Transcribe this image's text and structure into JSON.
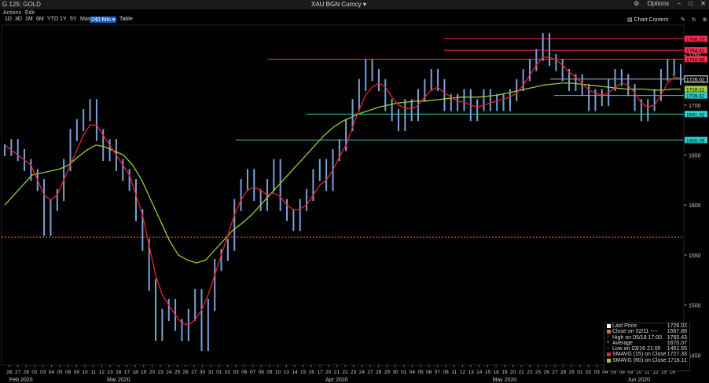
{
  "window": {
    "title_left": "G 125: GOLD",
    "security": "XAU BGN Curncy",
    "options_label": "Options"
  },
  "toolbar": {
    "actions_label": "Actions",
    "edit_label": "Edit",
    "ranges": [
      "1D",
      "3D",
      "1M",
      "6M",
      "YTD",
      "1Y",
      "5Y",
      "Max",
      "240 Min",
      "Table"
    ],
    "active_range": "240 Min",
    "chart_content_label": "Chart Content"
  },
  "colors": {
    "price_bars": "#7aa2d8",
    "sma15": "#e8232d",
    "sma60": "#9acd32",
    "resistance": "#ff2a4d",
    "support": "#2dd4d4",
    "close_marker": "#d87a1a",
    "last_price_label": "#ffffff"
  },
  "chart_data": {
    "type": "line",
    "title": "",
    "ylim": [
      1440,
      1780
    ],
    "y_ticks": [
      1450,
      1500,
      1550,
      1600,
      1650,
      1700,
      1750
    ],
    "x_ticks": [
      "26",
      "27",
      "28",
      "02",
      "03",
      "04",
      "05",
      "06",
      "09",
      "10",
      "11",
      "12",
      "13",
      "16",
      "17",
      "18",
      "19",
      "20",
      "23",
      "24",
      "25",
      "26",
      "27",
      "30",
      "31",
      "01",
      "02",
      "03",
      "06",
      "07",
      "08",
      "09",
      "10",
      "13",
      "14",
      "15",
      "16",
      "17",
      "20",
      "21",
      "22",
      "23",
      "24",
      "27",
      "28",
      "29",
      "30",
      "01",
      "04",
      "05",
      "06",
      "07",
      "08",
      "11",
      "12",
      "13",
      "14",
      "15",
      "18",
      "19",
      "20",
      "21",
      "22",
      "25",
      "26",
      "27",
      "28",
      "29",
      "01",
      "02",
      "03",
      "04",
      "05",
      "08",
      "09",
      "10",
      "11",
      "12",
      "15",
      "16"
    ],
    "months": [
      {
        "label": "Feb 2020",
        "tick": "26"
      },
      {
        "label": "Mar 2020",
        "tick": "13"
      },
      {
        "label": "Apr 2020",
        "tick": "16"
      },
      {
        "label": "May 2020",
        "tick": "13"
      },
      {
        "label": "Jun 2020",
        "tick": "08"
      }
    ],
    "horizontal_levels": [
      {
        "value": 1766.23,
        "label": "1766.23",
        "kind": "resistance"
      },
      {
        "value": 1754.81,
        "label": "1754.81",
        "kind": "resistance"
      },
      {
        "value": 1745.98,
        "label": "1745.98",
        "kind": "resistance"
      },
      {
        "value": 1726.02,
        "label": "1726.02",
        "kind": "last"
      },
      {
        "value": 1716.11,
        "label": "1716.11",
        "kind": "sma60"
      },
      {
        "value": 1709.62,
        "label": "1709.62",
        "kind": "support"
      },
      {
        "value": 1691.02,
        "label": "1691.02",
        "kind": "support"
      },
      {
        "value": 1665.05,
        "label": "1665.05",
        "kind": "support"
      }
    ],
    "close_reference": 1567.89,
    "price_points": [
      1655,
      1660,
      1650,
      1640,
      1630,
      1620,
      1575,
      1600,
      1610,
      1640,
      1670,
      1680,
      1690,
      1700,
      1670,
      1650,
      1660,
      1640,
      1630,
      1620,
      1590,
      1560,
      1520,
      1470,
      1490,
      1500,
      1480,
      1470,
      1490,
      1510,
      1460,
      1500,
      1540,
      1550,
      1560,
      1600,
      1620,
      1630,
      1610,
      1600,
      1620,
      1640,
      1600,
      1590,
      1580,
      1600,
      1610,
      1630,
      1640,
      1620,
      1650,
      1660,
      1680,
      1700,
      1720,
      1740,
      1730,
      1720,
      1700,
      1690,
      1680,
      1700,
      1690,
      1710,
      1720,
      1730,
      1720,
      1700,
      1705,
      1700,
      1710,
      1690,
      1700,
      1710,
      1700,
      1705,
      1700,
      1710,
      1720,
      1730,
      1740,
      1750,
      1766,
      1745,
      1740,
      1730,
      1720,
      1725,
      1715,
      1700,
      1710,
      1705,
      1720,
      1730,
      1725,
      1715,
      1700,
      1690,
      1700,
      1710,
      1730,
      1740,
      1735,
      1726
    ],
    "sma15_points": [
      1660,
      1655,
      1650,
      1645,
      1640,
      1625,
      1610,
      1605,
      1610,
      1625,
      1640,
      1655,
      1670,
      1680,
      1680,
      1670,
      1660,
      1650,
      1640,
      1630,
      1610,
      1590,
      1560,
      1530,
      1510,
      1500,
      1490,
      1482,
      1480,
      1485,
      1495,
      1510,
      1530,
      1550,
      1570,
      1590,
      1605,
      1615,
      1618,
      1615,
      1610,
      1612,
      1608,
      1600,
      1595,
      1596,
      1600,
      1610,
      1620,
      1625,
      1635,
      1648,
      1660,
      1678,
      1695,
      1710,
      1718,
      1722,
      1718,
      1708,
      1700,
      1697,
      1696,
      1700,
      1708,
      1715,
      1718,
      1712,
      1708,
      1704,
      1703,
      1700,
      1698,
      1700,
      1702,
      1704,
      1706,
      1708,
      1712,
      1720,
      1730,
      1740,
      1748,
      1748,
      1745,
      1740,
      1733,
      1728,
      1722,
      1715,
      1712,
      1710,
      1712,
      1718,
      1722,
      1720,
      1712,
      1702,
      1698,
      1700,
      1710,
      1722,
      1728,
      1727
    ],
    "sma60_points": [
      1600,
      1610,
      1620,
      1630,
      1632,
      1634,
      1636,
      1640,
      1648,
      1655,
      1660,
      1658,
      1654,
      1650,
      1640,
      1625,
      1605,
      1585,
      1565,
      1550,
      1545,
      1542,
      1545,
      1555,
      1565,
      1575,
      1582,
      1590,
      1600,
      1610,
      1620,
      1630,
      1640,
      1650,
      1660,
      1670,
      1678,
      1684,
      1688,
      1692,
      1695,
      1698,
      1700,
      1702,
      1703,
      1704,
      1704,
      1705,
      1706,
      1707,
      1708,
      1708,
      1708,
      1709,
      1710,
      1712,
      1714,
      1716,
      1718,
      1720,
      1721,
      1722,
      1722,
      1721,
      1720,
      1719,
      1718,
      1717,
      1716,
      1716,
      1716,
      1715,
      1715,
      1716,
      1716
    ],
    "legend": [
      {
        "name": "Last Price",
        "value": "1726.02",
        "swatch": "#ffffff"
      },
      {
        "name": "Close on 02/11 ----",
        "value": "1567.89",
        "swatch": "#d87a1a"
      },
      {
        "name": "High on 05/18 17:00",
        "value": "1765.43",
        "swatch": "none",
        "symbol": "↑"
      },
      {
        "name": "Average",
        "value": "1670.07",
        "swatch": "none",
        "symbol": "+"
      },
      {
        "name": "Low on 03/16 21:00",
        "value": "1451.55",
        "swatch": "none",
        "symbol": "↓"
      },
      {
        "name": "SMAVG (15)   on Close",
        "value": "1727.33",
        "swatch": "#e8232d"
      },
      {
        "name": "SMAVG (60)   on Close",
        "value": "1716.11",
        "swatch": "#9acd32"
      }
    ]
  }
}
